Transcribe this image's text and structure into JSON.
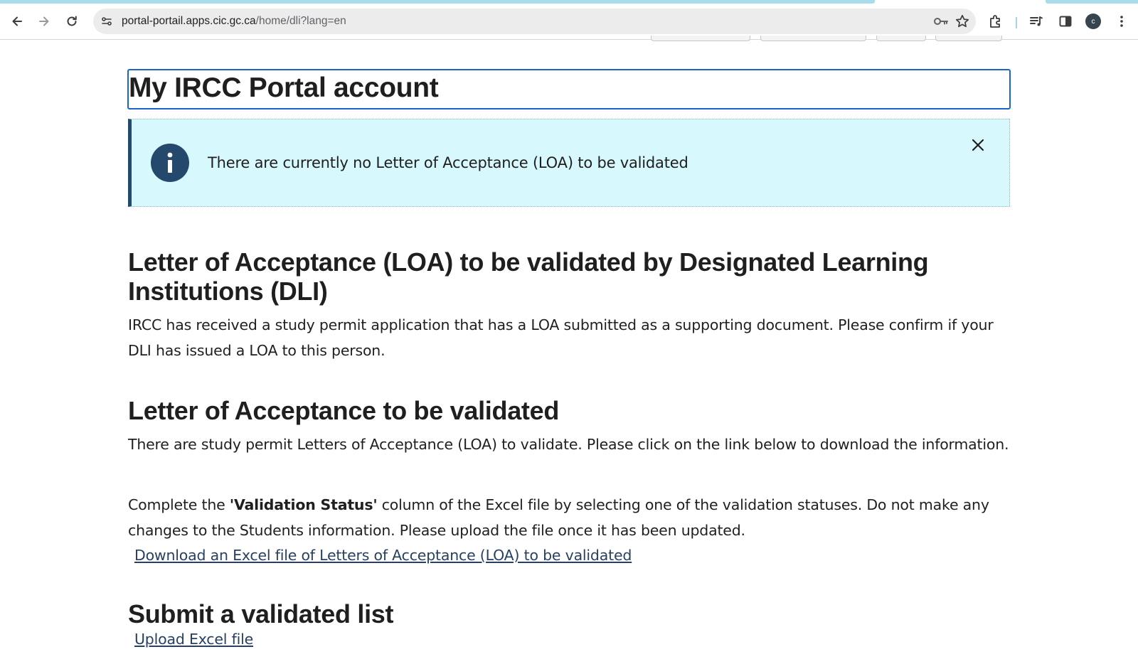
{
  "browser": {
    "url_host": "portal-portail.apps.cic.gc.ca",
    "url_path": "/home/dli?lang=en",
    "profile_initial": "c",
    "icons": [
      "back-arrow-icon",
      "forward-arrow-icon",
      "reload-icon",
      "site-info-icon",
      "key-icon",
      "star-icon",
      "extensions-icon",
      "media-controls-icon",
      "side-panel-icon",
      "kebab-menu-icon"
    ]
  },
  "page": {
    "title": "My IRCC Portal account",
    "alert": {
      "message": "There are currently no Letter of Acceptance (LOA) to be validated",
      "icon": "info-icon",
      "close_icon": "close-icon"
    },
    "loa_section": {
      "heading": "Letter of Acceptance (LOA) to be validated by Designated Learning Institutions (DLI)",
      "body": "IRCC has received a study permit application that has a LOA submitted as a supporting document. Please confirm if your DLI has issued a LOA to this person."
    },
    "validate_section": {
      "heading": "Letter of Acceptance to be validated",
      "body": "There are study permit Letters of Acceptance (LOA) to validate. Please click on the link below to download the information.",
      "instructions_prefix": "Complete the ",
      "instructions_bold": "'Validation Status'",
      "instructions_suffix": " column of the Excel file by selecting one of the validation statuses. Do not make any changes to the Students information. Please upload the file once it has been updated.",
      "download_link": "Download an Excel file of Letters of Acceptance (LOA) to be validated"
    },
    "submit_section": {
      "heading": "Submit a validated list",
      "upload_link": "Upload Excel file"
    },
    "colors": {
      "alert_bg": "#d7f8fc",
      "alert_border": "#25496d",
      "link": "#284162",
      "focus_outline": "#1b64c8"
    }
  }
}
